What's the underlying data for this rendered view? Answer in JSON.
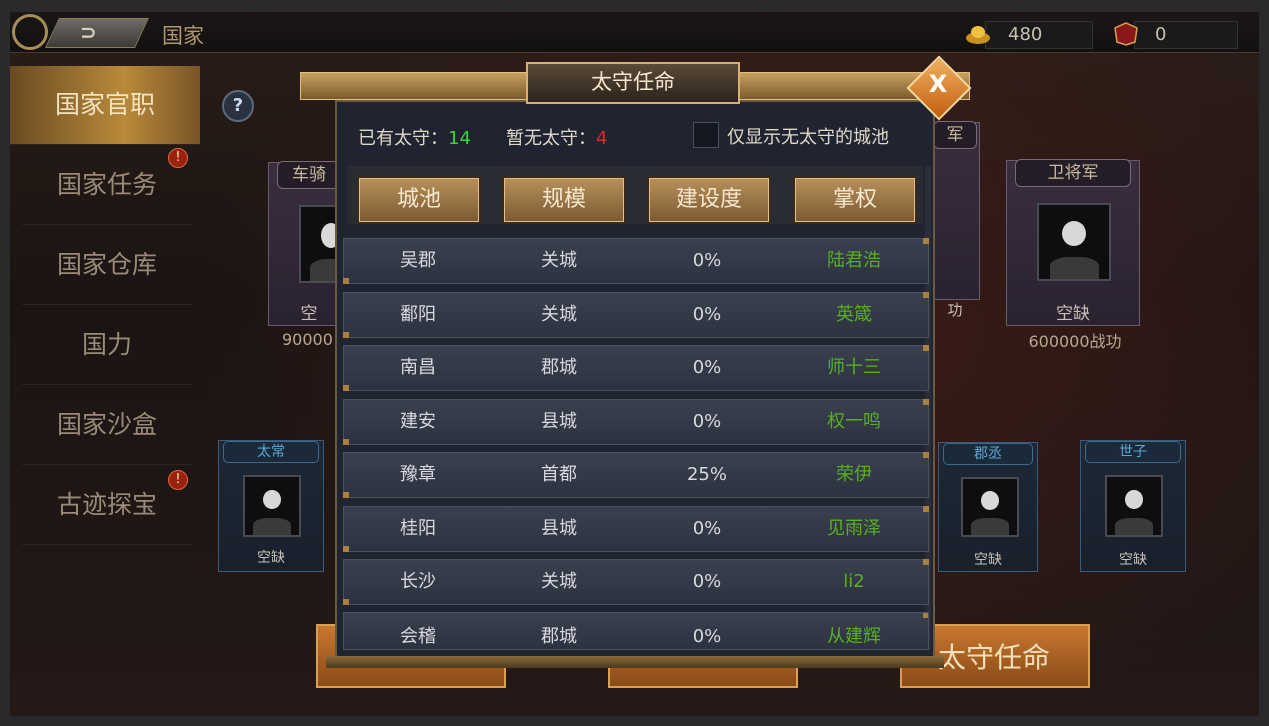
{
  "header": {
    "title": "国家",
    "gold_value": "480",
    "merit_value": "0",
    "back_label": "⊃"
  },
  "sidebar": {
    "items": [
      {
        "label": "国家官职",
        "active": true,
        "alert": false
      },
      {
        "label": "国家任务",
        "active": false,
        "alert": true
      },
      {
        "label": "国家仓库",
        "active": false,
        "alert": false
      },
      {
        "label": "国力",
        "active": false,
        "alert": false
      },
      {
        "label": "国家沙盒",
        "active": false,
        "alert": false
      },
      {
        "label": "古迹探宝",
        "active": false,
        "alert": true
      }
    ],
    "alert_glyph": "!"
  },
  "help_glyph": "?",
  "bg_cards": {
    "left_title": "车骑",
    "left_empty": "空",
    "left_power": "90000",
    "mid_title": "军",
    "mid_status": "功",
    "right_title": "卫将军",
    "right_empty": "空缺",
    "right_power": "600000战功",
    "small1_title": "太常",
    "small1_empty": "空缺",
    "small2_title": "郡丞",
    "small2_empty": "空缺",
    "small3_title": "世子",
    "small3_empty": "空缺",
    "bottom_button": "太守任命"
  },
  "dialog": {
    "title": "太守任命",
    "close_glyph": "X",
    "has_label": "已有太守：",
    "has_count": "14",
    "none_label": "暂无太守：",
    "none_count": "4",
    "filter_label": "仅显示无太守的城池",
    "columns": [
      "城池",
      "规模",
      "建设度",
      "掌权"
    ],
    "rows": [
      {
        "city": "吴郡",
        "scale": "关城",
        "build": "0%",
        "ruler": "陆君浩"
      },
      {
        "city": "鄱阳",
        "scale": "关城",
        "build": "0%",
        "ruler": "英箴"
      },
      {
        "city": "南昌",
        "scale": "郡城",
        "build": "0%",
        "ruler": "师十三"
      },
      {
        "city": "建安",
        "scale": "县城",
        "build": "0%",
        "ruler": "权一鸣"
      },
      {
        "city": "豫章",
        "scale": "首都",
        "build": "25%",
        "ruler": "荣伊"
      },
      {
        "city": "桂阳",
        "scale": "县城",
        "build": "0%",
        "ruler": "见雨泽"
      },
      {
        "city": "长沙",
        "scale": "关城",
        "build": "0%",
        "ruler": "li2"
      },
      {
        "city": "会稽",
        "scale": "郡城",
        "build": "0%",
        "ruler": "从建辉"
      }
    ]
  },
  "colors": {
    "accent_gold": "#c8a060",
    "count_green": "#3ed43e",
    "count_red": "#e02828",
    "ruler_green": "#58b020"
  }
}
